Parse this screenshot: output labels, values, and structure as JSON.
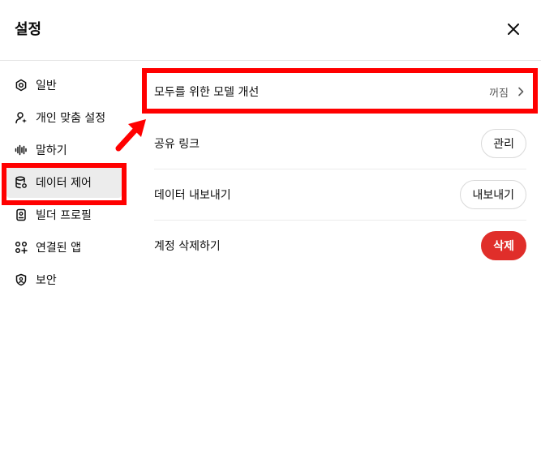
{
  "header": {
    "title": "설정"
  },
  "sidebar": {
    "items": [
      {
        "label": "일반",
        "icon": "gear-icon"
      },
      {
        "label": "개인 맞춤 설정",
        "icon": "person-sparkle-icon"
      },
      {
        "label": "말하기",
        "icon": "audio-wave-icon"
      },
      {
        "label": "데이터 제어",
        "icon": "database-settings-icon",
        "active": true
      },
      {
        "label": "빌더 프로필",
        "icon": "id-card-icon"
      },
      {
        "label": "연결된 앱",
        "icon": "apps-grid-icon"
      },
      {
        "label": "보안",
        "icon": "shield-lock-icon"
      }
    ]
  },
  "main": {
    "improve_model": {
      "label": "모두를 위한 모델 개선",
      "value": "꺼짐"
    },
    "shared_links": {
      "label": "공유 링크",
      "button": "관리"
    },
    "export_data": {
      "label": "데이터 내보내기",
      "button": "내보내기"
    },
    "delete_account": {
      "label": "계정 삭제하기",
      "button": "삭제"
    }
  },
  "colors": {
    "highlight": "#ff0000",
    "danger": "#e02e2a",
    "active_bg": "#ececec"
  }
}
